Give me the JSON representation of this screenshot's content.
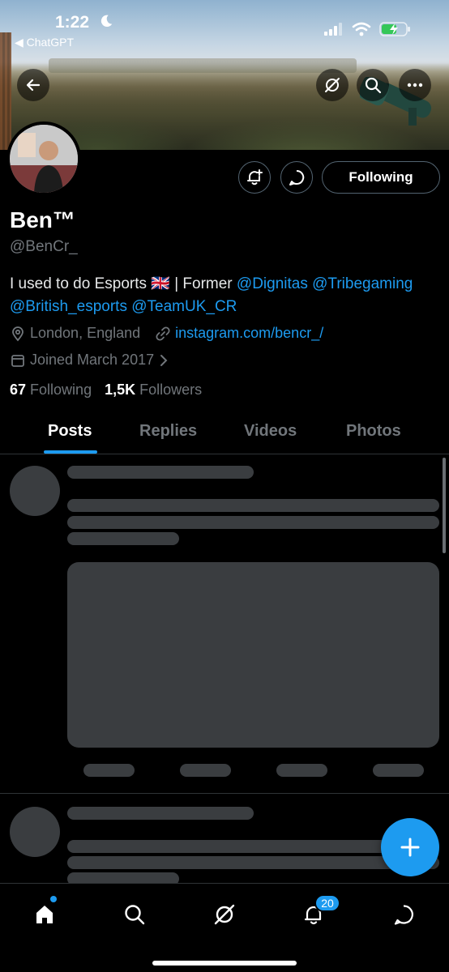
{
  "status": {
    "time": "1:22",
    "back_app": "◀ ChatGPT"
  },
  "profile": {
    "name": "Ben™",
    "handle": "@BenCr_",
    "bio_text": "I used to do Esports 🇬🇧 | Former ",
    "bio_mentions": [
      "@Dignitas",
      "@Tribegaming",
      "@British_esports",
      "@TeamUK_CR"
    ],
    "location": "London, England",
    "website": "instagram.com/bencr_/",
    "joined": "Joined March 2017",
    "following_count": "67",
    "following_label": "Following",
    "followers_count": "1,5K",
    "followers_label": "Followers",
    "follow_button_label": "Following"
  },
  "tabs": [
    {
      "label": "Posts",
      "active": true
    },
    {
      "label": "Replies",
      "active": false
    },
    {
      "label": "Videos",
      "active": false
    },
    {
      "label": "Photos",
      "active": false
    }
  ],
  "nav": {
    "notifications_badge": "20",
    "items": [
      "home-icon",
      "search-icon",
      "grok-icon",
      "bell-icon",
      "message-icon"
    ]
  },
  "colors": {
    "accent": "#1d9bf0",
    "background": "#000000",
    "skeleton": "#3a3d40"
  }
}
